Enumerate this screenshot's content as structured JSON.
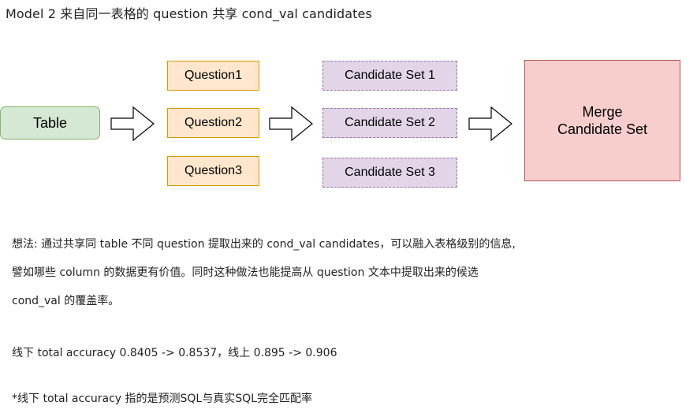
{
  "title": "Model 2 来自同一表格的 question 共享 cond_val candidates",
  "diagram": {
    "table_label": "Table",
    "questions": [
      "Question1",
      "Question2",
      "Question3"
    ],
    "candidate_sets": [
      "Candidate Set 1",
      "Candidate Set 2",
      "Candidate Set 3"
    ],
    "merge_label": "Merge\nCandidate Set",
    "colors": {
      "table_fill": "#d5e8d4",
      "table_border": "#82b366",
      "question_fill": "#ffe6cc",
      "question_border": "#d79b00",
      "candidate_fill": "#e1d5e7",
      "candidate_border": "#9673a6",
      "merge_fill": "#f8cecc",
      "merge_border": "#b85450"
    }
  },
  "notes": {
    "line1": "想法: 通过共享同 table 不同 question 提取出来的 cond_val candidates，可以融入表格级别的信息,",
    "line2": "譬如哪些 column 的数据更有价值。同时这种做法也能提高从 question 文本中提取出来的候选",
    "line3": "cond_val 的覆盖率。",
    "accuracy": "线下 total accuracy 0.8405 -> 0.8537，线上 0.895 -> 0.906",
    "footnote": "*线下 total accuracy 指的是预测SQL与真实SQL完全匹配率"
  }
}
